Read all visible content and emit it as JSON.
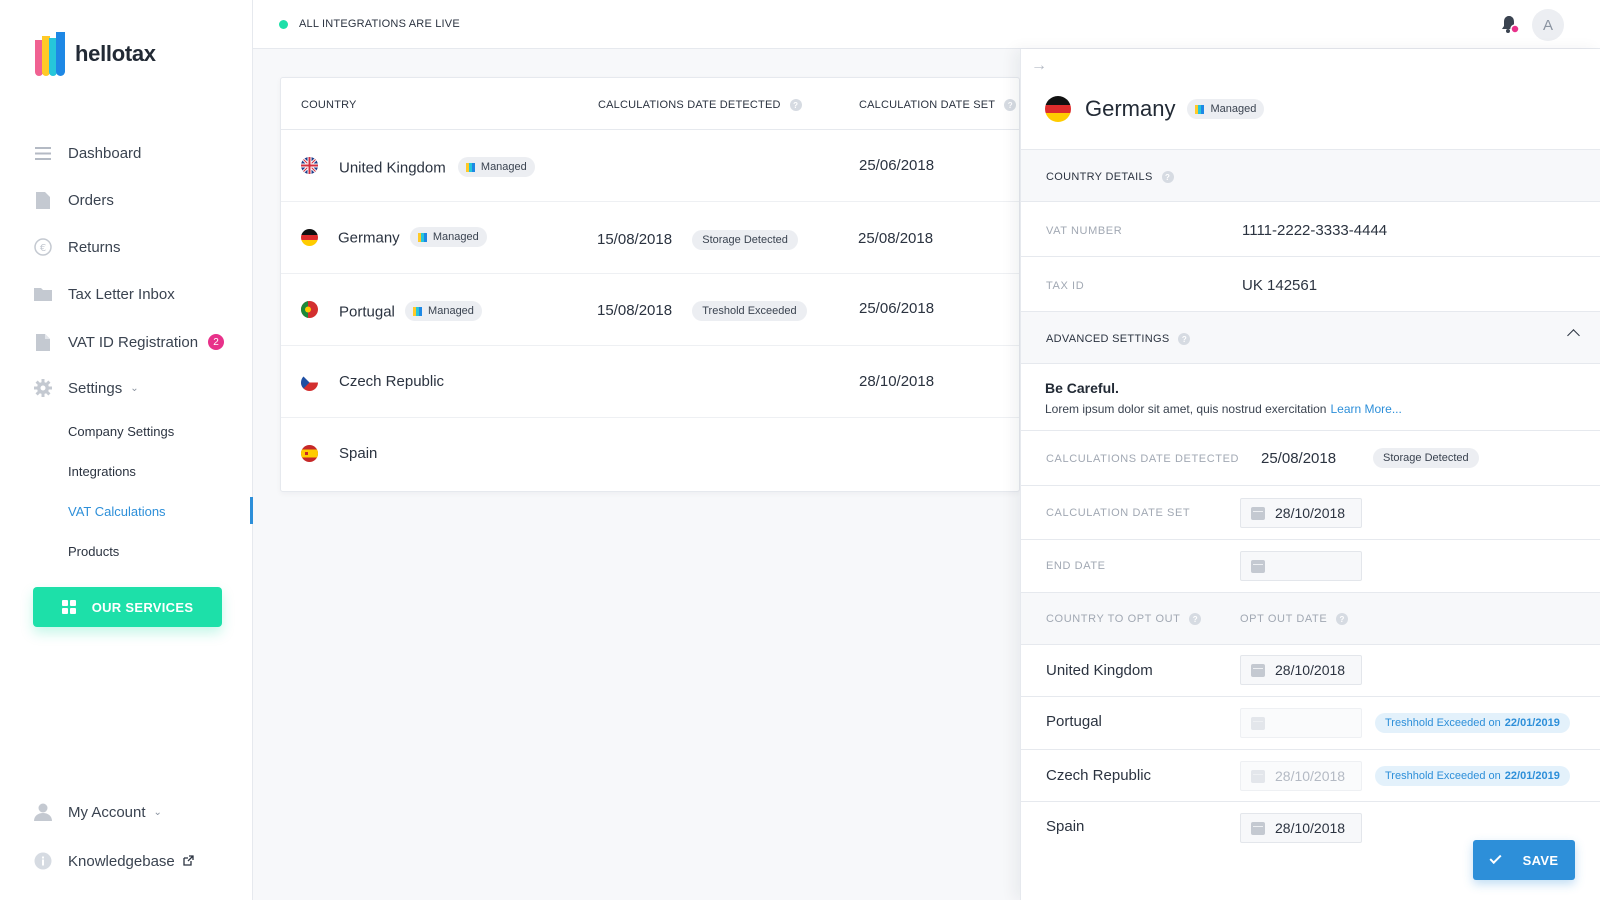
{
  "app": {
    "name": "hellotax"
  },
  "colors": {
    "accent_green": "#1de0a9",
    "accent_blue": "#2d8fd9",
    "badge_pink": "#e8318a"
  },
  "sidebar": {
    "nav": [
      {
        "label": "Dashboard",
        "icon": "list-icon"
      },
      {
        "label": "Orders",
        "icon": "document-icon"
      },
      {
        "label": "Returns",
        "icon": "euro-icon"
      },
      {
        "label": "Tax Letter Inbox",
        "icon": "folder-icon"
      },
      {
        "label": "VAT ID Registration",
        "icon": "file-icon",
        "badge": "2"
      },
      {
        "label": "Settings",
        "icon": "gear-icon"
      }
    ],
    "settings_sub": [
      "Company Settings",
      "Integrations",
      "VAT Calculations",
      "Products"
    ],
    "services_button": "OUR SERVICES",
    "account": "My Account",
    "knowledgebase": "Knowledgebase"
  },
  "topbar": {
    "status": "ALL INTEGRATIONS ARE LIVE",
    "avatar_initial": "A"
  },
  "table": {
    "headers": [
      "COUNTRY",
      "CALCULATIONS DATE DETECTED",
      "CALCULATION DATE SET"
    ],
    "managed_label": "Managed",
    "rows": [
      {
        "country": "United Kingdom",
        "managed": true,
        "detected": "",
        "detected_tag": "",
        "date_set": "25/06/2018"
      },
      {
        "country": "Germany",
        "managed": true,
        "detected": "15/08/2018",
        "detected_tag": "Storage Detected",
        "date_set": "25/08/2018"
      },
      {
        "country": "Portugal",
        "managed": true,
        "detected": "15/08/2018",
        "detected_tag": "Treshold Exceeded",
        "date_set": "25/06/2018"
      },
      {
        "country": "Czech Republic",
        "managed": false,
        "detected": "",
        "detected_tag": "",
        "date_set": "28/10/2018"
      },
      {
        "country": "Spain",
        "managed": false,
        "detected": "",
        "detected_tag": "",
        "date_set": ""
      }
    ]
  },
  "panel": {
    "country": "Germany",
    "managed_label": "Managed",
    "country_details_label": "COUNTRY DETAILS",
    "vat_number_label": "VAT NUMBER",
    "vat_number": "1111-2222-3333-4444",
    "tax_id_label": "TAX ID",
    "tax_id": "UK 142561",
    "advanced_label": "ADVANCED SETTINGS",
    "careful_title": "Be Careful.",
    "careful_text": "Lorem ipsum dolor sit amet, quis nostrud exercitation",
    "learn_more": "Learn More...",
    "calc_detected_label": "CALCULATIONS DATE DETECTED",
    "calc_detected": "25/08/2018",
    "calc_detected_tag": "Storage Detected",
    "calc_set_label": "CALCULATION DATE SET",
    "calc_set": "28/10/2018",
    "end_date_label": "END DATE",
    "end_date": "",
    "opt_out_country_label": "COUNTRY TO OPT OUT",
    "opt_out_date_label": "OPT OUT DATE",
    "opt_out": [
      {
        "country": "United Kingdom",
        "date": "28/10/2018",
        "disabled": false,
        "note": "",
        "note_date": ""
      },
      {
        "country": "Portugal",
        "date": "",
        "disabled": true,
        "note": "Treshhold Exceeded on",
        "note_date": "22/01/2019"
      },
      {
        "country": "Czech Republic",
        "date": "28/10/2018",
        "disabled": true,
        "note": "Treshhold Exceeded on",
        "note_date": "22/01/2019"
      },
      {
        "country": "Spain",
        "date": "28/10/2018",
        "disabled": false,
        "note": "",
        "note_date": ""
      }
    ],
    "save_label": "SAVE"
  }
}
